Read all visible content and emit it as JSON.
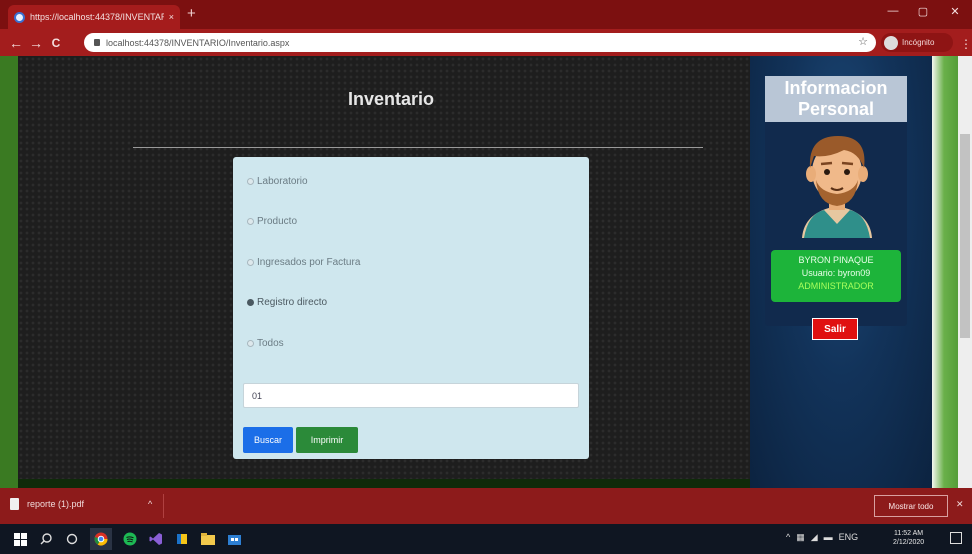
{
  "browser": {
    "tab_title": "https://localhost:44378/INVENTARIO/",
    "tab_close": "×",
    "new_tab": "+",
    "window_controls": {
      "minimize": "—",
      "maximize": "▢",
      "close": "✕"
    },
    "nav": {
      "back": "←",
      "forward": "→",
      "reload": "C"
    },
    "url": "localhost:44378/INVENTARIO/Inventario.aspx",
    "star": "☆",
    "profile_label": "Incógnito",
    "menu": "⋮",
    "accent_color": "#a31d1d"
  },
  "page": {
    "heading": "Inventario",
    "options": [
      {
        "label": "Laboratorio",
        "selected": false
      },
      {
        "label": "Producto",
        "selected": false
      },
      {
        "label": "Ingresados por Factura",
        "selected": false
      },
      {
        "label": "Registro directo",
        "selected": true
      },
      {
        "label": "Todos",
        "selected": false
      }
    ],
    "input_value": "01",
    "buscar_label": "Buscar",
    "imprimir_label": "Imprimir"
  },
  "sidebar": {
    "title": "Informacion Personal",
    "user_name": "BYRON PINAQUE",
    "usuario": "Usuario: byron09",
    "role": "ADMINISTRADOR",
    "salir_label": "Salir"
  },
  "downloads": {
    "file_name": "reporte (1).pdf",
    "caret": "^",
    "show_all": "Mostrar todo",
    "close": "✕"
  },
  "taskbar": {
    "lang": "ENG",
    "time": "11:52 AM",
    "date": "2/12/2020"
  }
}
